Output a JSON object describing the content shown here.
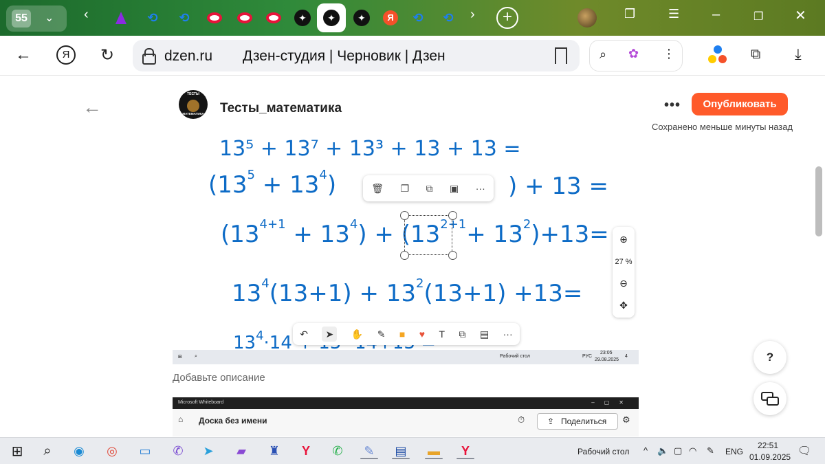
{
  "browser": {
    "tab_count": "55",
    "address": {
      "domain": "dzen.ru",
      "page_title": "Дзен-студия | Черновик | Дзен"
    }
  },
  "editor": {
    "channel_name": "Тесты_математика",
    "avatar_text_top": "ТЕСТЫ",
    "avatar_text_bottom": "МАТЕМАТИКА",
    "publish_label": "Опубликовать",
    "saved_status": "Сохранено меньше минуты назад",
    "more_label": "•••",
    "description_placeholder": "Добавьте описание"
  },
  "whiteboard_shot": {
    "zoom_level": "27 %",
    "line1": "13⁵ + 13⁷ + 13³ + 13 + 13 =",
    "inner_taskbar": {
      "desktop_label": "Рабочий стол",
      "lang": "РУС",
      "time": "23:05",
      "date": "29.08.2025",
      "badge": "4"
    }
  },
  "second_shot": {
    "app_title": "Microsoft Whiteboard",
    "board_name": "Доска без имени",
    "share_label": "Поделиться"
  },
  "help_label": "?",
  "taskbar": {
    "desktop_label": "Рабочий стол",
    "lang": "ENG",
    "time": "22:51",
    "date": "01.09.2025"
  },
  "colors": {
    "publish": "#ff5a2a",
    "ink": "#0d6bc6"
  }
}
